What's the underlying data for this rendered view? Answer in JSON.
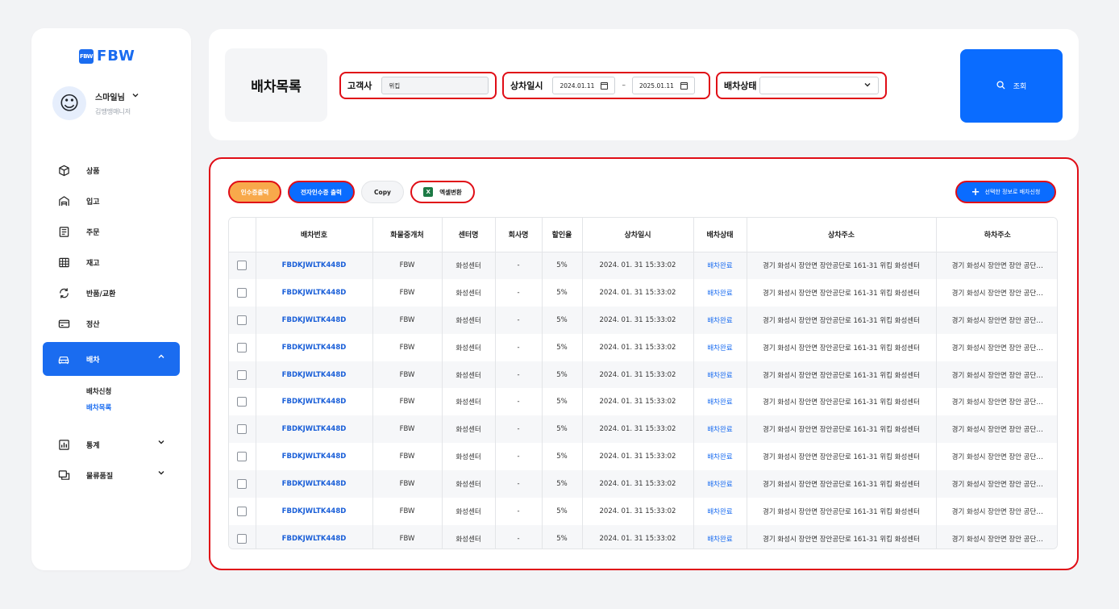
{
  "brand": {
    "logo_mark": "FBW",
    "logo_text": "FBW",
    "brand_color": "#1a6cf0"
  },
  "profile": {
    "name": "스마일님",
    "role": "김땡땡매니저",
    "avatar_icon": "smiling-face-icon"
  },
  "sidebar": {
    "items": [
      {
        "label": "상품",
        "icon": "cube-icon"
      },
      {
        "label": "입고",
        "icon": "warehouse-icon"
      },
      {
        "label": "주문",
        "icon": "receipt-icon"
      },
      {
        "label": "재고",
        "icon": "grid-icon"
      },
      {
        "label": "반품/교환",
        "icon": "refresh-icon"
      },
      {
        "label": "정산",
        "icon": "card-icon"
      },
      {
        "label": "배차",
        "icon": "car-icon",
        "active": true
      },
      {
        "label": "통계",
        "icon": "bar-chart-icon"
      },
      {
        "label": "물류품질",
        "icon": "chat-icon"
      }
    ],
    "subitems": [
      {
        "label": "배차신청"
      },
      {
        "label": "배차목록",
        "current": true
      }
    ]
  },
  "header": {
    "page_title": "배차목록",
    "customer_label": "고객사",
    "customer_value": "위킵",
    "date_label": "상차일시",
    "date_from": "2024.01.11",
    "date_sep": "–",
    "date_to": "2025.01.11",
    "status_label": "배차상태",
    "status_value": "",
    "search_label": "조회"
  },
  "toolbar": {
    "receipt_print": "인수증출력",
    "e_receipt_print": "전자인수증 출력",
    "copy": "Copy",
    "excel_convert": "엑셀변환",
    "apply_selected": "선택한 정보로 배차신청"
  },
  "table": {
    "columns": [
      "",
      "배차번호",
      "화물중개처",
      "센터명",
      "회사명",
      "할인율",
      "상차일시",
      "배차상태",
      "상차주소",
      "하차주소"
    ],
    "rows": [
      [
        "FBDKJWLTK448D",
        "FBW",
        "화성센터",
        "-",
        "5%",
        "2024. 01. 31 15:33:02",
        "배차완료",
        "경기 화성시 장안면 장안공단로 161-31 위킵 화성센터",
        "경기 화성시 장안면 장안 공단…"
      ],
      [
        "FBDKJWLTK448D",
        "FBW",
        "화성센터",
        "-",
        "5%",
        "2024. 01. 31 15:33:02",
        "배차완료",
        "경기 화성시 장안면 장안공단로 161-31 위킵 화성센터",
        "경기 화성시 장안면 장안 공단…"
      ],
      [
        "FBDKJWLTK448D",
        "FBW",
        "화성센터",
        "-",
        "5%",
        "2024. 01. 31 15:33:02",
        "배차완료",
        "경기 화성시 장안면 장안공단로 161-31 위킵 화성센터",
        "경기 화성시 장안면 장안 공단…"
      ],
      [
        "FBDKJWLTK448D",
        "FBW",
        "화성센터",
        "-",
        "5%",
        "2024. 01. 31 15:33:02",
        "배차완료",
        "경기 화성시 장안면 장안공단로 161-31 위킵 화성센터",
        "경기 화성시 장안면 장안 공단…"
      ],
      [
        "FBDKJWLTK448D",
        "FBW",
        "화성센터",
        "-",
        "5%",
        "2024. 01. 31 15:33:02",
        "배차완료",
        "경기 화성시 장안면 장안공단로 161-31 위킵 화성센터",
        "경기 화성시 장안면 장안 공단…"
      ],
      [
        "FBDKJWLTK448D",
        "FBW",
        "화성센터",
        "-",
        "5%",
        "2024. 01. 31 15:33:02",
        "배차완료",
        "경기 화성시 장안면 장안공단로 161-31 위킵 화성센터",
        "경기 화성시 장안면 장안 공단…"
      ],
      [
        "FBDKJWLTK448D",
        "FBW",
        "화성센터",
        "-",
        "5%",
        "2024. 01. 31 15:33:02",
        "배차완료",
        "경기 화성시 장안면 장안공단로 161-31 위킵 화성센터",
        "경기 화성시 장안면 장안 공단…"
      ],
      [
        "FBDKJWLTK448D",
        "FBW",
        "화성센터",
        "-",
        "5%",
        "2024. 01. 31 15:33:02",
        "배차완료",
        "경기 화성시 장안면 장안공단로 161-31 위킵 화성센터",
        "경기 화성시 장안면 장안 공단…"
      ],
      [
        "FBDKJWLTK448D",
        "FBW",
        "화성센터",
        "-",
        "5%",
        "2024. 01. 31 15:33:02",
        "배차완료",
        "경기 화성시 장안면 장안공단로 161-31 위킵 화성센터",
        "경기 화성시 장안면 장안 공단…"
      ],
      [
        "FBDKJWLTK448D",
        "FBW",
        "화성센터",
        "-",
        "5%",
        "2024. 01. 31 15:33:02",
        "배차완료",
        "경기 화성시 장안면 장안공단로 161-31 위킵 화성센터",
        "경기 화성시 장안면 장안 공단…"
      ],
      [
        "FBDKJWLTK448D",
        "FBW",
        "화성센터",
        "-",
        "5%",
        "2024. 01. 31 15:33:02",
        "배차완료",
        "경기 화성시 장안면 장안공단로 161-31 위킵 화성센터",
        "경기 화성시 장안면 장안 공단…"
      ]
    ]
  },
  "colors": {
    "primary": "#0a6cff",
    "highlight_border": "#e00d16",
    "orange": "#f8a94b",
    "excel_green": "#1d7a45"
  }
}
